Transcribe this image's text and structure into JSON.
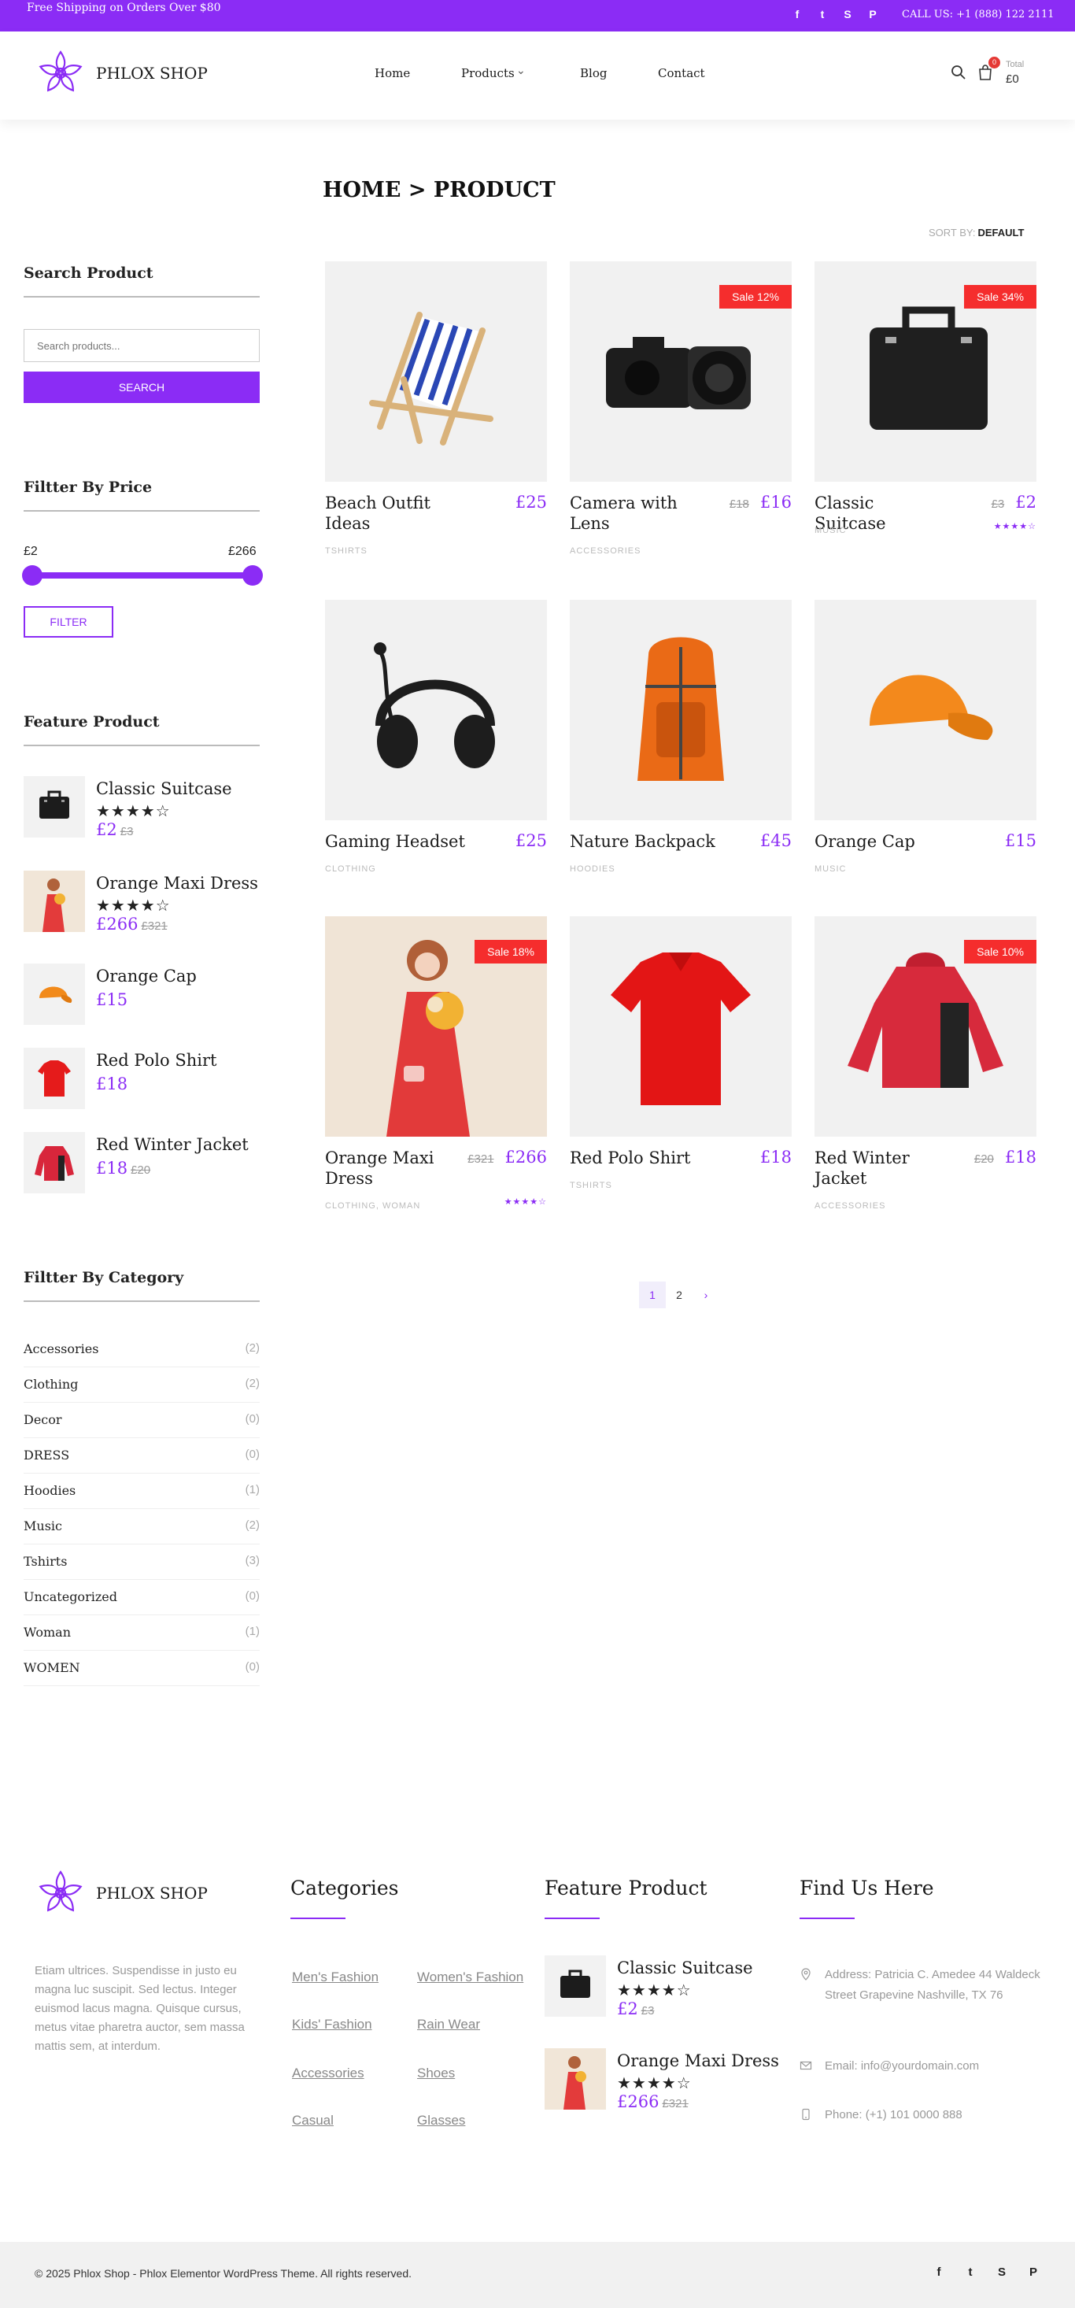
{
  "topbar": {
    "promo": "Free Shipping on Orders Over $80",
    "call": "CALL US: +1 (888) 122 2111",
    "social": [
      {
        "icon": "facebook-icon",
        "glyph": "f"
      },
      {
        "icon": "twitter-icon",
        "glyph": "t"
      },
      {
        "icon": "skype-icon",
        "glyph": "S"
      },
      {
        "icon": "pinterest-icon",
        "glyph": "P"
      }
    ]
  },
  "header": {
    "logo_text": "PHLOX SHOP",
    "nav": [
      "Home",
      "Products",
      "Blog",
      "Contact"
    ],
    "products_chevron": "⌄",
    "cart_count": "0",
    "cart_total_label": "Total",
    "cart_total": "£0"
  },
  "page": {
    "title": "HOME > PRODUCT",
    "sort_label": "SORT BY:",
    "sort_value": "DEFAULT"
  },
  "sidebar": {
    "search_title": "Search Product",
    "search_placeholder": "Search products...",
    "search_button": "SEARCH",
    "price_title": "Filtter By Price",
    "price_min": "£2",
    "price_max": "£266",
    "filter_button": "FILTER",
    "feature_title": "Feature Product",
    "feature_items": [
      {
        "name": "Classic Suitcase",
        "stars": "★★★★☆",
        "price": "£2",
        "old": "£3"
      },
      {
        "name": "Orange Maxi Dress",
        "stars": "★★★★☆",
        "price": "£266",
        "old": "£321"
      },
      {
        "name": "Orange Cap",
        "stars": "",
        "price": "£15",
        "old": ""
      },
      {
        "name": "Red Polo Shirt",
        "stars": "",
        "price": "£18",
        "old": ""
      },
      {
        "name": "Red Winter Jacket",
        "stars": "",
        "price": "£18",
        "old": "£20"
      }
    ],
    "category_title": "Filtter By Category",
    "categories": [
      {
        "name": "Accessories",
        "count": "(2)"
      },
      {
        "name": "Clothing",
        "count": "(2)"
      },
      {
        "name": "Decor",
        "count": "(0)"
      },
      {
        "name": "DRESS",
        "count": "(0)"
      },
      {
        "name": "Hoodies",
        "count": "(1)"
      },
      {
        "name": "Music",
        "count": "(2)"
      },
      {
        "name": "Tshirts",
        "count": "(3)"
      },
      {
        "name": "Uncategorized",
        "count": "(0)"
      },
      {
        "name": "Woman",
        "count": "(1)"
      },
      {
        "name": "WOMEN",
        "count": "(0)"
      }
    ]
  },
  "products": [
    {
      "name": "Beach Outfit Ideas",
      "price": "£25",
      "old": "",
      "sale": "",
      "category": "TSHIRTS",
      "stars": ""
    },
    {
      "name": "Camera with Lens",
      "price": "£16",
      "old": "£18",
      "sale": "Sale 12%",
      "category": "ACCESSORIES",
      "stars": ""
    },
    {
      "name": "Classic Suitcase",
      "price": "£2",
      "old": "£3",
      "sale": "Sale 34%",
      "category": "MUSIC",
      "stars": "★★★★☆"
    },
    {
      "name": "Gaming Headset",
      "price": "£25",
      "old": "",
      "sale": "",
      "category": "CLOTHING",
      "stars": ""
    },
    {
      "name": "Nature Backpack",
      "price": "£45",
      "old": "",
      "sale": "",
      "category": "HOODIES",
      "stars": ""
    },
    {
      "name": "Orange Cap",
      "price": "£15",
      "old": "",
      "sale": "",
      "category": "MUSIC",
      "stars": ""
    },
    {
      "name": "Orange Maxi Dress",
      "price": "£266",
      "old": "£321",
      "sale": "Sale 18%",
      "category": "CLOTHING, WOMAN",
      "stars": "★★★★☆"
    },
    {
      "name": "Red Polo Shirt",
      "price": "£18",
      "old": "",
      "sale": "",
      "category": "TSHIRTS",
      "stars": ""
    },
    {
      "name": "Red Winter Jacket",
      "price": "£18",
      "old": "£20",
      "sale": "Sale 10%",
      "category": "ACCESSORIES",
      "stars": ""
    }
  ],
  "pagination": {
    "pages": [
      "1",
      "2"
    ],
    "next": "›"
  },
  "footer": {
    "logo_text": "PHLOX SHOP",
    "about": "Etiam ultrices. Suspendisse in justo eu magna luc suscipit. Sed lectus. Integer euismod lacus magna. Quisque cursus, metus vitae pharetra auctor, sem massa mattis sem, at interdum.",
    "categories_title": "Categories",
    "categories": [
      "Men's Fashion",
      "Women's Fashion",
      "Kids' Fashion",
      "Rain Wear",
      "Accessories",
      "Shoes",
      "Casual",
      "Glasses"
    ],
    "feature_title": "Feature Product",
    "feature_items": [
      {
        "name": "Classic Suitcase",
        "stars": "★★★★☆",
        "price": "£2",
        "old": "£3"
      },
      {
        "name": "Orange Maxi Dress",
        "stars": "★★★★☆",
        "price": "£266",
        "old": "£321"
      }
    ],
    "find_title": "Find Us Here",
    "address": "Address: Patricia C. Amedee 44 Waldeck Street Grapevine Nashville, TX 76",
    "email": "Email: info@yourdomain.com",
    "phone": "Phone: (+1) 101 0000 888",
    "copyright": "© 2025 Phlox Shop - Phlox Elementor WordPress Theme. All rights reserved."
  },
  "colors": {
    "accent": "#8b2cf5",
    "sale": "#f52d2d"
  }
}
